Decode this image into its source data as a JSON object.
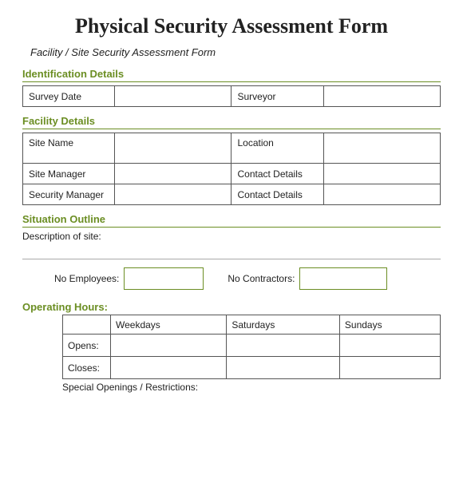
{
  "title": "Physical Security Assessment Form",
  "subtitle": "Facility / Site Security Assessment Form",
  "sections": {
    "identification": {
      "label": "Identification Details",
      "fields": [
        {
          "label": "Survey Date",
          "value": ""
        },
        {
          "label": "Surveyor",
          "value": ""
        }
      ]
    },
    "facility": {
      "label": "Facility Details",
      "rows": [
        [
          {
            "label": "Site Name",
            "value": "",
            "tall": true
          },
          {
            "label": "Location",
            "value": "",
            "tall": true
          }
        ],
        [
          {
            "label": "Site Manager",
            "value": ""
          },
          {
            "label": "Contact Details",
            "value": ""
          }
        ],
        [
          {
            "label": "Security Manager",
            "value": ""
          },
          {
            "label": "Contact Details",
            "value": ""
          }
        ]
      ]
    },
    "situation": {
      "label": "Situation Outline",
      "desc_label": "Description of site:",
      "no_employees_label": "No Employees:",
      "no_contractors_label": "No Contractors:"
    },
    "operating_hours": {
      "label": "Operating Hours:",
      "columns": [
        "Weekdays",
        "Saturdays",
        "Sundays"
      ],
      "rows": [
        {
          "label": "Opens:"
        },
        {
          "label": "Closes:"
        }
      ],
      "special_label": "Special Openings / Restrictions:"
    }
  }
}
